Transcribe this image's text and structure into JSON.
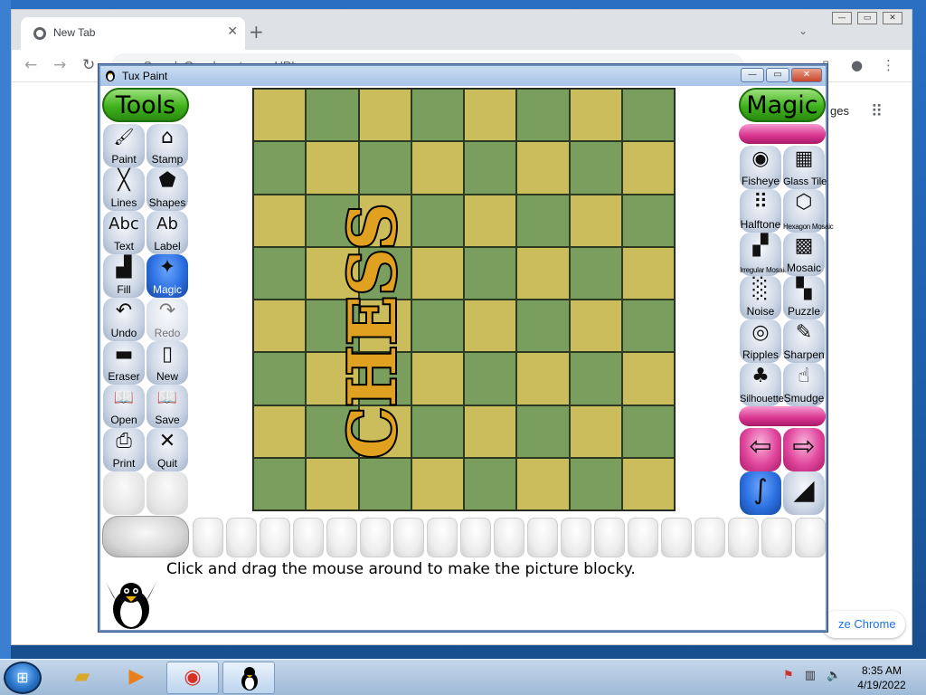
{
  "chrome": {
    "tab_title": "New Tab",
    "omnibox_placeholder": "Search Google or type a URL",
    "images_link": "ges",
    "customize_label": "ze Chrome"
  },
  "tuxpaint": {
    "window_title": "Tux Paint",
    "tools_header": "Tools",
    "magic_header": "Magic",
    "tools": [
      {
        "label": "Paint",
        "icon": "paintbrush-icon",
        "glyph": "🖌"
      },
      {
        "label": "Stamp",
        "icon": "stamp-icon",
        "glyph": "⌂"
      },
      {
        "label": "Lines",
        "icon": "lines-icon",
        "glyph": "╳"
      },
      {
        "label": "Shapes",
        "icon": "pentagon-icon",
        "glyph": "⬟"
      },
      {
        "label": "Text",
        "icon": "text-icon",
        "glyph": "Abc"
      },
      {
        "label": "Label",
        "icon": "label-icon",
        "glyph": "Ab"
      },
      {
        "label": "Fill",
        "icon": "bucket-icon",
        "glyph": "▟"
      },
      {
        "label": "Magic",
        "icon": "wand-icon",
        "glyph": "✦",
        "active": true
      },
      {
        "label": "Undo",
        "icon": "undo-icon",
        "glyph": "↶"
      },
      {
        "label": "Redo",
        "icon": "redo-icon",
        "glyph": "↷",
        "disabled": true
      },
      {
        "label": "Eraser",
        "icon": "eraser-icon",
        "glyph": "▬"
      },
      {
        "label": "New",
        "icon": "new-icon",
        "glyph": "▯"
      },
      {
        "label": "Open",
        "icon": "open-icon",
        "glyph": "📖"
      },
      {
        "label": "Save",
        "icon": "save-icon",
        "glyph": "📖"
      },
      {
        "label": "Print",
        "icon": "printer-icon",
        "glyph": "⎙"
      },
      {
        "label": "Quit",
        "icon": "quit-icon",
        "glyph": "✕"
      }
    ],
    "magic": [
      {
        "label": "Fisheye",
        "icon": "fisheye-icon",
        "glyph": "◉"
      },
      {
        "label": "Glass Tile",
        "icon": "glass-tile-icon",
        "glyph": "▦"
      },
      {
        "label": "Halftone",
        "icon": "halftone-icon",
        "glyph": "⠿"
      },
      {
        "label": "Hexagon Mosaic",
        "icon": "hexagon-icon",
        "glyph": "⬡",
        "small": true
      },
      {
        "label": "Irregular Mosaic",
        "icon": "irregular-mosaic-icon",
        "glyph": "▞",
        "small": true
      },
      {
        "label": "Mosaic",
        "icon": "mosaic-icon",
        "glyph": "▩"
      },
      {
        "label": "Noise",
        "icon": "noise-icon",
        "glyph": "░"
      },
      {
        "label": "Puzzle",
        "icon": "puzzle-icon",
        "glyph": "▚"
      },
      {
        "label": "Ripples",
        "icon": "ripples-icon",
        "glyph": "◎"
      },
      {
        "label": "Sharpen",
        "icon": "sharpen-icon",
        "glyph": "✎"
      },
      {
        "label": "Silhouette",
        "icon": "silhouette-icon",
        "glyph": "♣"
      },
      {
        "label": "Smudge",
        "icon": "smudge-icon",
        "glyph": "☝"
      }
    ],
    "magic_controls": [
      {
        "icon": "arrow-left-icon",
        "glyph": "⇦"
      },
      {
        "icon": "arrow-right-icon",
        "glyph": "⇨"
      },
      {
        "icon": "paint-mode-icon",
        "glyph": "∫"
      },
      {
        "icon": "fullscreen-mode-icon",
        "glyph": "◢"
      }
    ],
    "canvas_text": "CHESS",
    "help_text": "Click and drag the mouse around to make the picture blocky.",
    "board_colors": {
      "light": "#cbbd5c",
      "dark": "#7a9e5e"
    }
  },
  "taskbar": {
    "time": "8:35 AM",
    "date": "4/19/2022"
  }
}
